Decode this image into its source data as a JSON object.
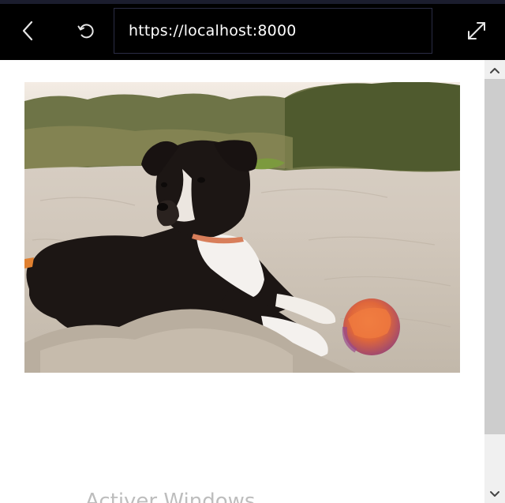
{
  "browser": {
    "address_url": "https://localhost:8000",
    "icons": {
      "back": "chevron-left-icon",
      "refresh": "refresh-icon",
      "expand": "expand-icon"
    }
  },
  "page": {
    "image": {
      "description_icon": "puppy-on-beach-photo"
    }
  },
  "overlay": {
    "watermark_text": "Activer Windows"
  },
  "scrollbar": {
    "position_fraction": 0.0,
    "visible_fraction": 0.85
  },
  "colors": {
    "toolbar_bg": "#000000",
    "address_border": "#2b2d45",
    "scroll_track": "#f0f0f0",
    "scroll_thumb": "#cdcdcd"
  }
}
